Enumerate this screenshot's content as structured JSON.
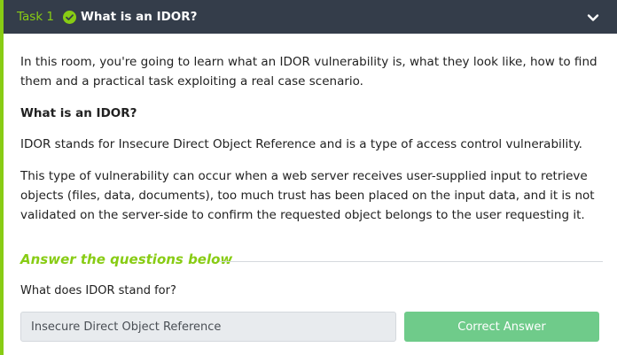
{
  "task": {
    "number_label": "Task 1",
    "title": "What is an IDOR?",
    "completed": true,
    "expanded": true,
    "icons": {
      "status": "check-circle-icon",
      "toggle": "chevron-up-icon"
    }
  },
  "content": {
    "intro": "In this room, you're going to learn what an IDOR vulnerability is, what they look like, how to find them and a practical task exploiting a real case scenario.",
    "heading": "What is an IDOR?",
    "definition": "IDOR stands for Insecure Direct Object Reference and is a type of access control vulnerability.",
    "explanation": "This type of vulnerability can occur when a web server receives user-supplied input to retrieve objects (files, data, documents), too much trust has been placed on the input data, and it is not validated on the server-side to confirm the requested object belongs to the user requesting it."
  },
  "questions": {
    "heading": "Answer the questions below",
    "items": [
      {
        "question": "What does IDOR stand for?",
        "answer_value": "Insecure Direct Object Reference",
        "button_label": "Correct Answer"
      }
    ]
  },
  "colors": {
    "accent": "#88cc14",
    "header_bg": "#343d4a",
    "correct_button": "#6fcb8a"
  }
}
